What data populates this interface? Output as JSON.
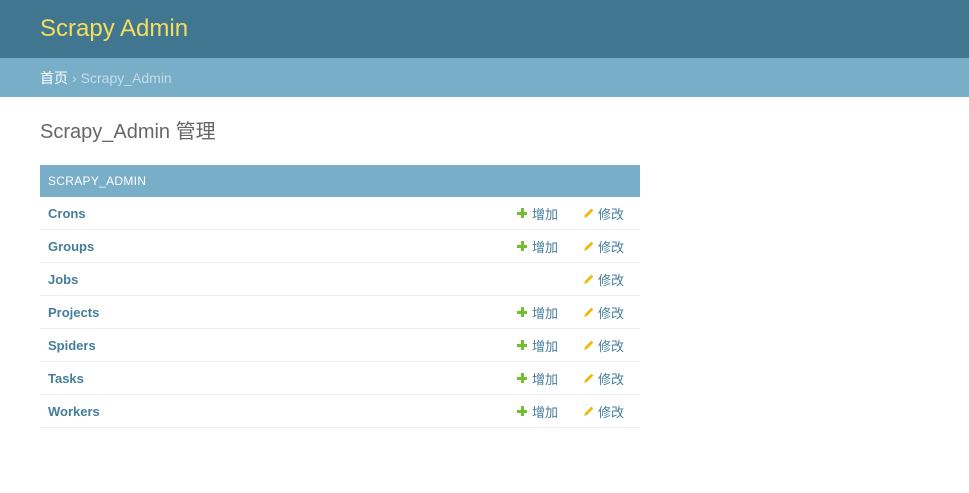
{
  "header": {
    "site_name": "Scrapy Admin"
  },
  "breadcrumbs": {
    "home": "首页",
    "separator": "›",
    "current": "Scrapy_Admin"
  },
  "page": {
    "title": "Scrapy_Admin 管理"
  },
  "module": {
    "caption": "Scrapy_Admin",
    "models": [
      {
        "name": "Crons",
        "add_label": "增加",
        "change_label": "修改"
      },
      {
        "name": "Groups",
        "add_label": "增加",
        "change_label": "修改"
      },
      {
        "name": "Jobs",
        "add_label": "",
        "change_label": "修改"
      },
      {
        "name": "Projects",
        "add_label": "增加",
        "change_label": "修改"
      },
      {
        "name": "Spiders",
        "add_label": "增加",
        "change_label": "修改"
      },
      {
        "name": "Tasks",
        "add_label": "增加",
        "change_label": "修改"
      },
      {
        "name": "Workers",
        "add_label": "增加",
        "change_label": "修改"
      }
    ]
  },
  "icons": {
    "add": "plus-icon",
    "change": "pencil-icon"
  },
  "colors": {
    "header_bg": "#417690",
    "site_name": "#f5dd5d",
    "breadcrumbs_bg": "#79aec8",
    "caption_bg": "#79aec8",
    "link": "#447e9b",
    "add_icon": "#70bf2b",
    "change_icon": "#efb80b"
  }
}
